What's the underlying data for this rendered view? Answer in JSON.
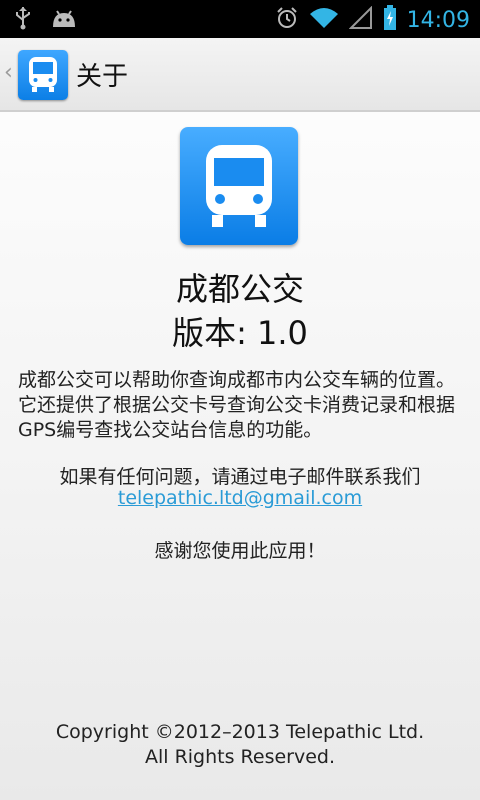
{
  "status_bar": {
    "time": "14:09",
    "icons": [
      "usb-icon",
      "android-icon",
      "alarm-icon",
      "wifi-icon",
      "signal-icon",
      "battery-icon"
    ]
  },
  "action_bar": {
    "title": "关于",
    "up_icon": "chevron-left-icon",
    "app_icon": "bus-icon"
  },
  "about": {
    "app_name": "成都公交",
    "version": "版本: 1.0",
    "description": "成都公交可以帮助你查询成都市内公交车辆的位置。它还提供了根据公交卡号查询公交卡消费记录和根据GPS编号查找公交站台信息的功能。",
    "contact_text": "如果有任何问题，请通过电子邮件联系我们",
    "email": "telepathic.ltd@gmail.com",
    "thanks": "感谢您使用此应用！",
    "copyright_line1": "Copyright ©2012–2013 Telepathic Ltd.",
    "copyright_line2": "All Rights Reserved."
  },
  "colors": {
    "accent": "#33b5e5",
    "icon_blue": "#1a8cf0",
    "link": "#2a9bd6"
  }
}
